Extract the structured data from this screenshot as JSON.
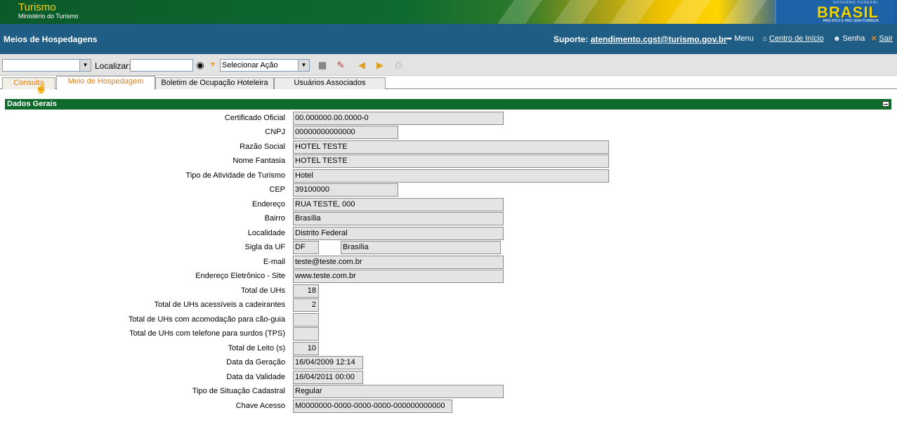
{
  "banner": {
    "logo_title": "Turismo",
    "logo_subtitle": "Ministério do Turismo",
    "brasil_top": "GOVERNO FEDERAL",
    "brasil_word": "BRASIL",
    "brasil_sub": "PAÍS RICO É PAÍS SEM POBREZA"
  },
  "header": {
    "page_title": "Meios de Hospedagens",
    "support_label": "Suporte:",
    "support_email": "atendimento.cgst@turismo.gov.br",
    "nav": {
      "menu": "Menu",
      "inicio": "Centro de Início",
      "senha": "Senha",
      "sair": "Sair"
    }
  },
  "toolbar": {
    "first_select_value": "",
    "localizar_label": "Localizar:",
    "localizar_value": "",
    "acao_select_value": "Selecionar Ação",
    "icons": [
      "binoculars-icon",
      "dropdown-triangle-icon",
      "save-icon",
      "eraser-icon",
      "back-arrow-icon",
      "forward-arrow-icon",
      "print-icon"
    ]
  },
  "tabs": [
    {
      "label": "Consulta",
      "active": false
    },
    {
      "label": "Meio de Hospedagem",
      "active": true
    },
    {
      "label": "Boletim de Ocupação Hoteleira",
      "active": false
    },
    {
      "label": "Usuários Associados",
      "active": false
    }
  ],
  "section": {
    "title": "Dados Gerais"
  },
  "fields": {
    "certificado": {
      "label": "Certificado Oficial",
      "value": "00.000000.00.0000-0"
    },
    "cnpj": {
      "label": "CNPJ",
      "value": "00000000000000"
    },
    "razao": {
      "label": "Razão Social",
      "value": "HOTEL TESTE"
    },
    "fantasia": {
      "label": "Nome Fantasia",
      "value": "HOTEL TESTE"
    },
    "tipo_atividade": {
      "label": "Tipo de Atividade de Turismo",
      "value": "Hotel"
    },
    "cep": {
      "label": "CEP",
      "value": "39100000"
    },
    "endereco": {
      "label": "Endereço",
      "value": "RUA TESTE, 000"
    },
    "bairro": {
      "label": "Bairro",
      "value": "Brasília"
    },
    "localidade": {
      "label": "Localidade",
      "value": "Distrito Federal"
    },
    "uf": {
      "label": "Sigla da UF",
      "value": "DF",
      "value2": "Brasília"
    },
    "email": {
      "label": "E-mail",
      "value": "teste@teste.com.br"
    },
    "site": {
      "label": "Endereço Eletrônico - Site",
      "value": "www.teste.com.br"
    },
    "total_uhs": {
      "label": "Total de UHs",
      "value": "18"
    },
    "uhs_cadeirantes": {
      "label": "Total de UHs acessíveis a cadeirantes",
      "value": "2"
    },
    "uhs_caoguia": {
      "label": "Total de UHs com acomodação para cão-guia",
      "value": ""
    },
    "uhs_tps": {
      "label": "Total de UHs com telefone para surdos (TPS)",
      "value": ""
    },
    "total_leito": {
      "label": "Total de Leito (s)",
      "value": "10"
    },
    "data_geracao": {
      "label": "Data da Geração",
      "value": "16/04/2009 12:14"
    },
    "data_validade": {
      "label": "Data da Validade",
      "value": "16/04/2011 00:00"
    },
    "situacao": {
      "label": "Tipo de Situação Cadastral",
      "value": "Regular"
    },
    "chave": {
      "label": "Chave Acesso",
      "value": "M0000000-0000-0000-0000-000000000000"
    }
  }
}
